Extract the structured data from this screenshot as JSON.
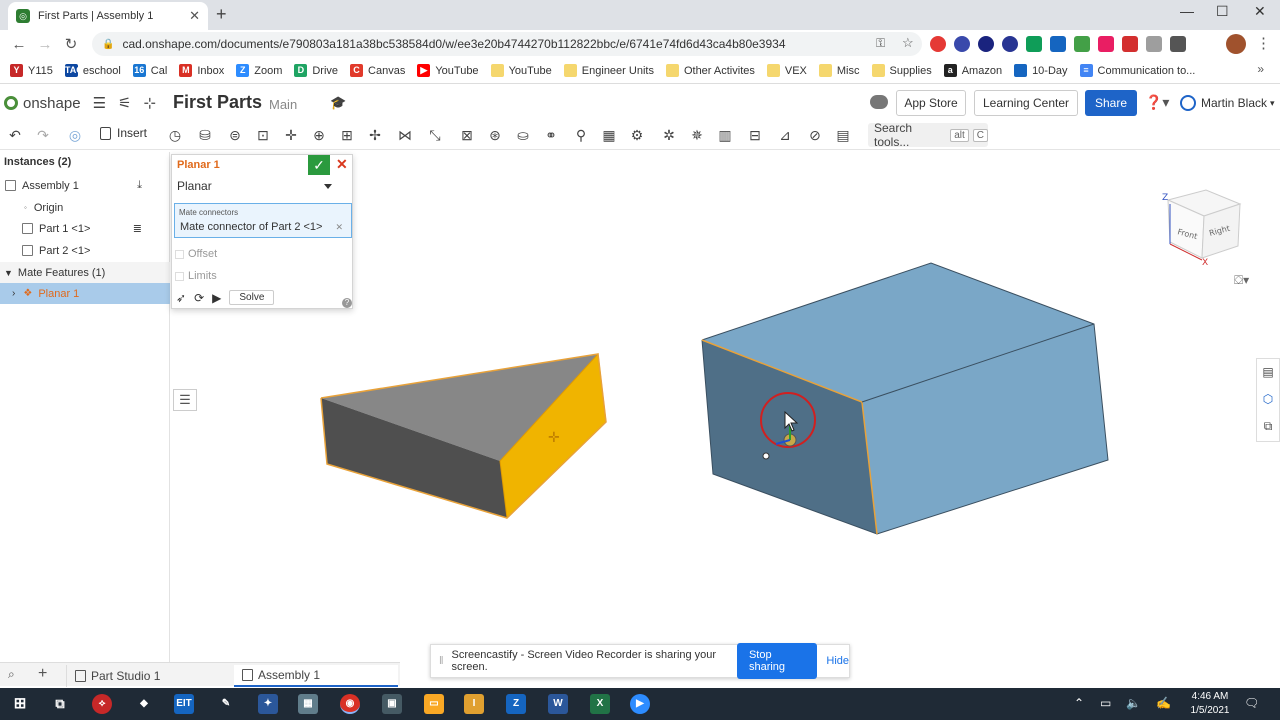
{
  "browser": {
    "tab_title": "First Parts | Assembly 1",
    "tab_favicon": "onshape-icon",
    "url": "cad.onshape.com/documents/e790803a181a38bc538584d0/w/ee3e20b4744270b112822bbc/e/6741e74fd6d43ca4b80e3934",
    "bookmarks": [
      {
        "label": "Y115",
        "icon": "Y",
        "color": "#c62828"
      },
      {
        "label": "eschool",
        "icon": "TAC",
        "color": "#0d47a1"
      },
      {
        "label": "Cal",
        "icon": "16",
        "color": "#1976d2"
      },
      {
        "label": "Inbox",
        "icon": "M",
        "color": "#d93025"
      },
      {
        "label": "Zoom",
        "icon": "Z",
        "color": "#2d8cff"
      },
      {
        "label": "Drive",
        "icon": "D",
        "color": "#1fa463"
      },
      {
        "label": "Canvas",
        "icon": "C",
        "color": "#e13a2b"
      },
      {
        "label": "YouTube",
        "icon": "▶",
        "color": "#ff0000"
      },
      {
        "label": "YouTube",
        "icon": "",
        "color": "#f5d76e"
      },
      {
        "label": "Engineer Units",
        "icon": "",
        "color": "#f5d76e"
      },
      {
        "label": "Other Activites",
        "icon": "",
        "color": "#f5d76e"
      },
      {
        "label": "VEX",
        "icon": "",
        "color": "#f5d76e"
      },
      {
        "label": "Misc",
        "icon": "",
        "color": "#f5d76e"
      },
      {
        "label": "Supplies",
        "icon": "",
        "color": "#f5d76e"
      },
      {
        "label": "Amazon",
        "icon": "a",
        "color": "#222222"
      },
      {
        "label": "10-Day",
        "icon": "",
        "color": "#1565c0"
      },
      {
        "label": "Communication to...",
        "icon": "≡",
        "color": "#4285f4"
      }
    ],
    "more": "»"
  },
  "header": {
    "logo_text": "onshape",
    "doc_title": "First Parts",
    "branch": "Main",
    "app_store": "App Store",
    "learning_center": "Learning Center",
    "share": "Share",
    "help": "?",
    "user_name": "Martin Black"
  },
  "toolbar": {
    "insert_label": "Insert",
    "search_label": "Search tools...",
    "kbd_alt": "alt",
    "kbd_c": "C"
  },
  "left_panel": {
    "title": "Instances (2)",
    "items": [
      {
        "label": "Assembly 1"
      },
      {
        "label": "Origin"
      },
      {
        "label": "Part 1 <1>"
      },
      {
        "label": "Part 2 <1>"
      },
      {
        "label": "Mate Features (1)"
      },
      {
        "label": "Planar 1"
      }
    ]
  },
  "dialog": {
    "title": "Planar 1",
    "type": "Planar",
    "connectors_label": "Mate connectors",
    "connector_value": "Mate connector of Part 2 <1>",
    "offset": "Offset",
    "limits": "Limits",
    "solve": "Solve"
  },
  "viewcube": {
    "front": "Front",
    "right": "Right",
    "z": "Z",
    "x": "X"
  },
  "bottom_tabs": [
    {
      "label": "Part Studio 1"
    },
    {
      "label": "Assembly 1"
    }
  ],
  "banner": {
    "message": "Screencastify - Screen Video Recorder is sharing your screen.",
    "stop": "Stop sharing",
    "hide": "Hide"
  },
  "taskbar": {
    "time": "4:46 AM",
    "date": "1/5/2021"
  },
  "colors": {
    "accent": "#1e64c8",
    "selection": "#a9cbea",
    "highlight_orange": "#e06a1c",
    "part_blue": "#7aa7c7",
    "part_yellow": "#f0b400"
  }
}
